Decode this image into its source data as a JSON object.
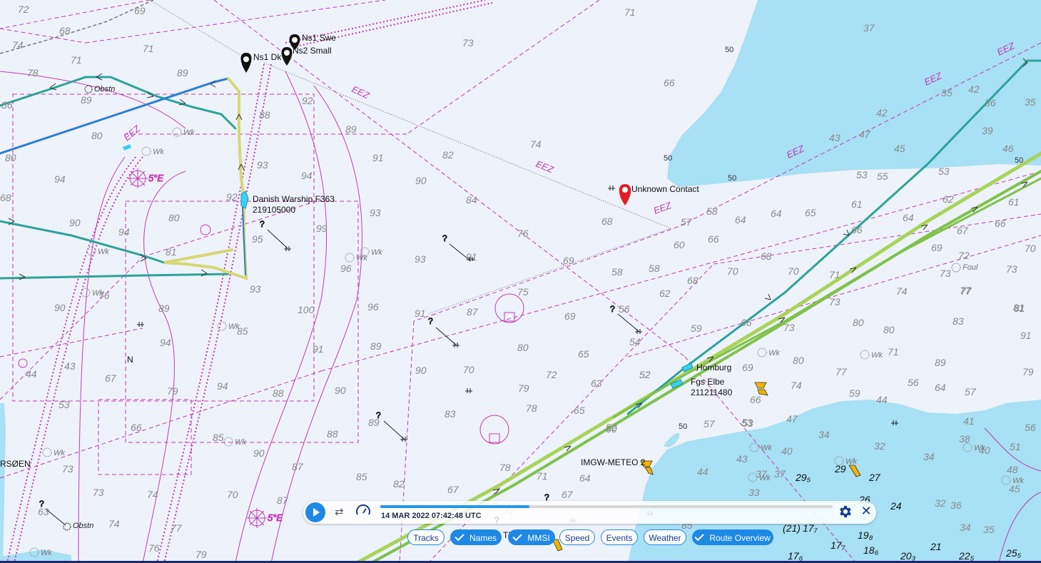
{
  "map": {
    "labels": {
      "ns1_swe": "Ns1 Swe",
      "ns2_small": "Ns2 Small",
      "ns1_dk": "Ns1 Dk",
      "danish_warship_name": "Danish Warship F363",
      "danish_warship_mmsi": "219105000",
      "unknown_contact": "Unknown Contact",
      "homburg": "Homburg",
      "fgs_elbe_name": "Fgs Elbe",
      "fgs_elbe_mmsi": "211211480",
      "imgw_meteo": "IMGW-METEO 2",
      "obstn_top": "Obstn",
      "obstn_bottom": "Obstn",
      "foul": "Foul",
      "rsoen": "RSØEN",
      "n_mark": "N",
      "te_fragment": "TE",
      "longitude_top": "5°E",
      "longitude_bottom": "5°E"
    },
    "eez_label": "EEZ",
    "wk_label": "Wk",
    "contour_labels": [
      "50",
      "50",
      "50",
      "50",
      "50"
    ],
    "depths_light": [
      {
        "t": "72"
      },
      {
        "t": "69"
      },
      {
        "t": "71"
      },
      {
        "t": "68"
      },
      {
        "t": "74"
      },
      {
        "t": "71"
      },
      {
        "t": "73"
      },
      {
        "t": "71"
      },
      {
        "t": "78"
      },
      {
        "t": "89"
      },
      {
        "t": "86"
      },
      {
        "t": "89"
      },
      {
        "t": "92"
      },
      {
        "t": "88"
      },
      {
        "t": "89"
      },
      {
        "t": "80"
      },
      {
        "t": "80"
      },
      {
        "t": "91"
      },
      {
        "t": "82"
      },
      {
        "t": "74"
      },
      {
        "t": "66"
      },
      {
        "t": "94"
      },
      {
        "t": "93"
      },
      {
        "t": "94"
      },
      {
        "t": "90"
      },
      {
        "t": "84"
      },
      {
        "t": "68"
      },
      {
        "t": "92"
      },
      {
        "t": "80"
      },
      {
        "t": "90"
      },
      {
        "t": "94"
      },
      {
        "t": "93"
      },
      {
        "t": "76"
      },
      {
        "t": "99"
      },
      {
        "t": "81"
      },
      {
        "t": "95"
      },
      {
        "t": "93"
      },
      {
        "t": "69"
      },
      {
        "t": "91"
      },
      {
        "t": "96"
      },
      {
        "t": "68"
      },
      {
        "t": "58"
      },
      {
        "t": "58"
      },
      {
        "t": "60"
      },
      {
        "t": "66"
      },
      {
        "t": "57"
      },
      {
        "t": "93"
      },
      {
        "t": "75"
      },
      {
        "t": "62"
      },
      {
        "t": "76"
      },
      {
        "t": "90"
      },
      {
        "t": "89"
      },
      {
        "t": "100"
      },
      {
        "t": "96"
      },
      {
        "t": "91"
      },
      {
        "t": "87"
      },
      {
        "t": "69"
      },
      {
        "t": "56"
      },
      {
        "t": "68"
      },
      {
        "t": "85"
      },
      {
        "t": "94"
      },
      {
        "t": "91"
      },
      {
        "t": "89"
      },
      {
        "t": "80"
      },
      {
        "t": "54"
      },
      {
        "t": "59"
      },
      {
        "t": "52"
      },
      {
        "t": "44"
      },
      {
        "t": "43"
      },
      {
        "t": "67"
      },
      {
        "t": "79"
      },
      {
        "t": "94"
      },
      {
        "t": "88"
      },
      {
        "t": "90"
      },
      {
        "t": "65"
      },
      {
        "t": "52"
      },
      {
        "t": "53"
      },
      {
        "t": "90"
      },
      {
        "t": "70"
      },
      {
        "t": "72"
      },
      {
        "t": "63"
      },
      {
        "t": "66"
      },
      {
        "t": "79"
      },
      {
        "t": "78"
      },
      {
        "t": "65"
      },
      {
        "t": "52"
      },
      {
        "t": "57"
      },
      {
        "t": "53"
      },
      {
        "t": "83"
      },
      {
        "t": "89"
      },
      {
        "t": "85"
      },
      {
        "t": "88"
      },
      {
        "t": "60"
      },
      {
        "t": "66"
      },
      {
        "t": "73"
      },
      {
        "t": "90"
      },
      {
        "t": "87"
      },
      {
        "t": "78"
      },
      {
        "t": "71"
      },
      {
        "t": "64"
      },
      {
        "t": "73"
      },
      {
        "t": "74"
      },
      {
        "t": "70"
      },
      {
        "t": "87"
      },
      {
        "t": "85"
      },
      {
        "t": "82"
      },
      {
        "t": "67"
      },
      {
        "t": "67"
      },
      {
        "t": "63"
      },
      {
        "t": "74"
      },
      {
        "t": "77"
      },
      {
        "t": "76"
      },
      {
        "t": "79"
      },
      {
        "t": "72"
      },
      {
        "t": "53"
      },
      {
        "t": "85"
      },
      {
        "t": "44"
      },
      {
        "t": "43"
      },
      {
        "t": "33"
      },
      {
        "t": "37"
      },
      {
        "t": "40"
      },
      {
        "t": "37"
      },
      {
        "t": "58"
      },
      {
        "t": "64"
      },
      {
        "t": "64"
      },
      {
        "t": "65"
      },
      {
        "t": "61"
      },
      {
        "t": "66"
      },
      {
        "t": "68"
      },
      {
        "t": "70"
      },
      {
        "t": "70"
      },
      {
        "t": "66"
      },
      {
        "t": "73"
      },
      {
        "t": "71"
      },
      {
        "t": "74"
      },
      {
        "t": "69"
      },
      {
        "t": "80"
      },
      {
        "t": "74"
      },
      {
        "t": "73"
      },
      {
        "t": "77"
      },
      {
        "t": "81"
      },
      {
        "t": "80"
      },
      {
        "t": "80"
      },
      {
        "t": "71"
      },
      {
        "t": "77"
      },
      {
        "t": "89"
      },
      {
        "t": "56"
      },
      {
        "t": "64"
      },
      {
        "t": "59"
      },
      {
        "t": "57"
      },
      {
        "t": "47"
      },
      {
        "t": "44"
      },
      {
        "t": "34"
      },
      {
        "t": "32"
      },
      {
        "t": "34"
      },
      {
        "t": "38"
      },
      {
        "t": "41"
      },
      {
        "t": "40"
      },
      {
        "t": "56"
      },
      {
        "t": "51"
      },
      {
        "t": "48"
      },
      {
        "t": "45"
      },
      {
        "t": "36"
      },
      {
        "t": "32"
      },
      {
        "t": "34"
      },
      {
        "t": "35"
      },
      {
        "t": "37"
      },
      {
        "t": "42"
      },
      {
        "t": "42"
      },
      {
        "t": "43"
      },
      {
        "t": "47"
      },
      {
        "t": "45"
      },
      {
        "t": "35"
      },
      {
        "t": "36"
      },
      {
        "t": "35"
      },
      {
        "t": "39"
      },
      {
        "t": "46"
      },
      {
        "t": "53"
      },
      {
        "t": "53"
      },
      {
        "t": "55"
      },
      {
        "t": "62"
      },
      {
        "t": "64"
      },
      {
        "t": "67"
      },
      {
        "t": "69"
      },
      {
        "t": "72"
      },
      {
        "t": "61"
      },
      {
        "t": "66"
      },
      {
        "t": "70"
      },
      {
        "t": "73"
      },
      {
        "t": "73"
      },
      {
        "t": "77"
      },
      {
        "t": "83"
      },
      {
        "t": "81"
      },
      {
        "t": "91"
      },
      {
        "t": "79"
      }
    ],
    "depths_dark": [
      {
        "t": "29₅"
      },
      {
        "t": "29"
      },
      {
        "t": "27"
      },
      {
        "t": "26"
      },
      {
        "t": "24"
      },
      {
        "t": "17₇"
      },
      {
        "t": "19₈"
      },
      {
        "t": "17₇"
      },
      {
        "t": "18₆"
      },
      {
        "t": "21"
      },
      {
        "t": "20₃"
      },
      {
        "t": "22₅"
      },
      {
        "t": "25₅"
      },
      {
        "t": "17₆"
      },
      {
        "t": "(21)"
      }
    ]
  },
  "player": {
    "timestamp": "14 MAR 2022 07:42:48 UTC",
    "progress_fraction": 0.33
  },
  "chips": [
    {
      "label": "Tracks",
      "active": false
    },
    {
      "label": "Names",
      "active": true
    },
    {
      "label": "MMSI",
      "active": true
    },
    {
      "label": "Speed",
      "active": false
    },
    {
      "label": "Events",
      "active": false
    },
    {
      "label": "Weather",
      "active": false
    },
    {
      "label": "Route Overview",
      "active": true
    }
  ],
  "colors": {
    "sea": "#eef2fb",
    "shallow": "#a8e0f5",
    "track_green": "#a8d45a",
    "track_teal": "#2aa39a",
    "track_blue": "#2b7fd0",
    "boundary_magenta": "#c03bb5",
    "accent_blue": "#1e88e5"
  }
}
